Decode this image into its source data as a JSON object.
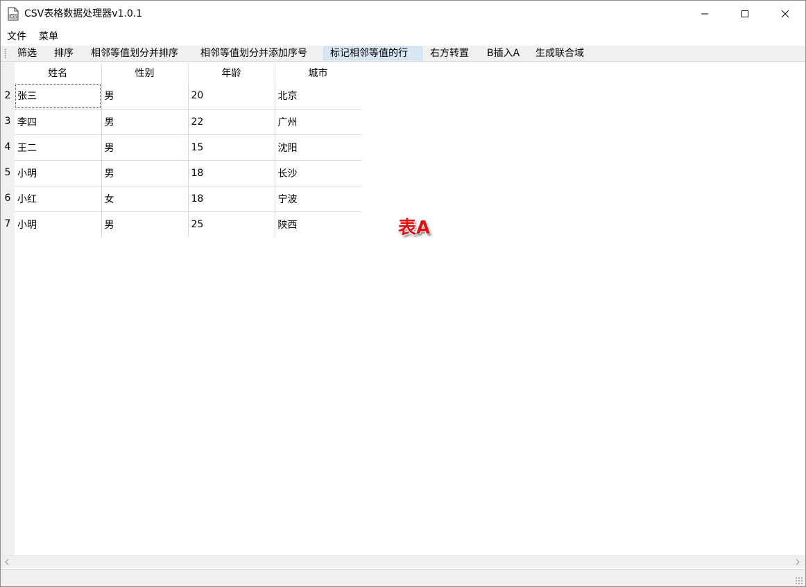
{
  "window": {
    "title": "CSV表格数据处理器v1.0.1",
    "icon": "csv-file-icon"
  },
  "menu": {
    "file_label": "文件",
    "menu_label": "菜单"
  },
  "toolbar": {
    "buttons": [
      {
        "label": "筛选"
      },
      {
        "label": "排序"
      },
      {
        "label": "相邻等值划分并排序"
      },
      {
        "label": "相邻等值划分并添加序号"
      },
      {
        "label": "标记相邻等值的行",
        "active": true
      },
      {
        "label": "右方转置"
      },
      {
        "label": "B插入A"
      },
      {
        "label": "生成联合域"
      }
    ]
  },
  "table": {
    "columns": [
      "姓名",
      "性别",
      "年龄",
      "城市"
    ],
    "rows": [
      {
        "row_number": "2",
        "cells": [
          "张三",
          "男",
          "20",
          "北京"
        ]
      },
      {
        "row_number": "3",
        "cells": [
          "李四",
          "男",
          "22",
          "广州"
        ]
      },
      {
        "row_number": "4",
        "cells": [
          "王二",
          "男",
          "15",
          "沈阳"
        ]
      },
      {
        "row_number": "5",
        "cells": [
          "小明",
          "男",
          "18",
          "长沙"
        ]
      },
      {
        "row_number": "6",
        "cells": [
          "小红",
          "女",
          "18",
          "宁波"
        ]
      },
      {
        "row_number": "7",
        "cells": [
          "小明",
          "男",
          "25",
          "陕西"
        ]
      }
    ]
  },
  "overlay": {
    "label": "表A",
    "color": "#e01010"
  },
  "colors": {
    "active_tool_bg": "#d9e7f5",
    "chrome_bg": "#f0f0f0"
  }
}
